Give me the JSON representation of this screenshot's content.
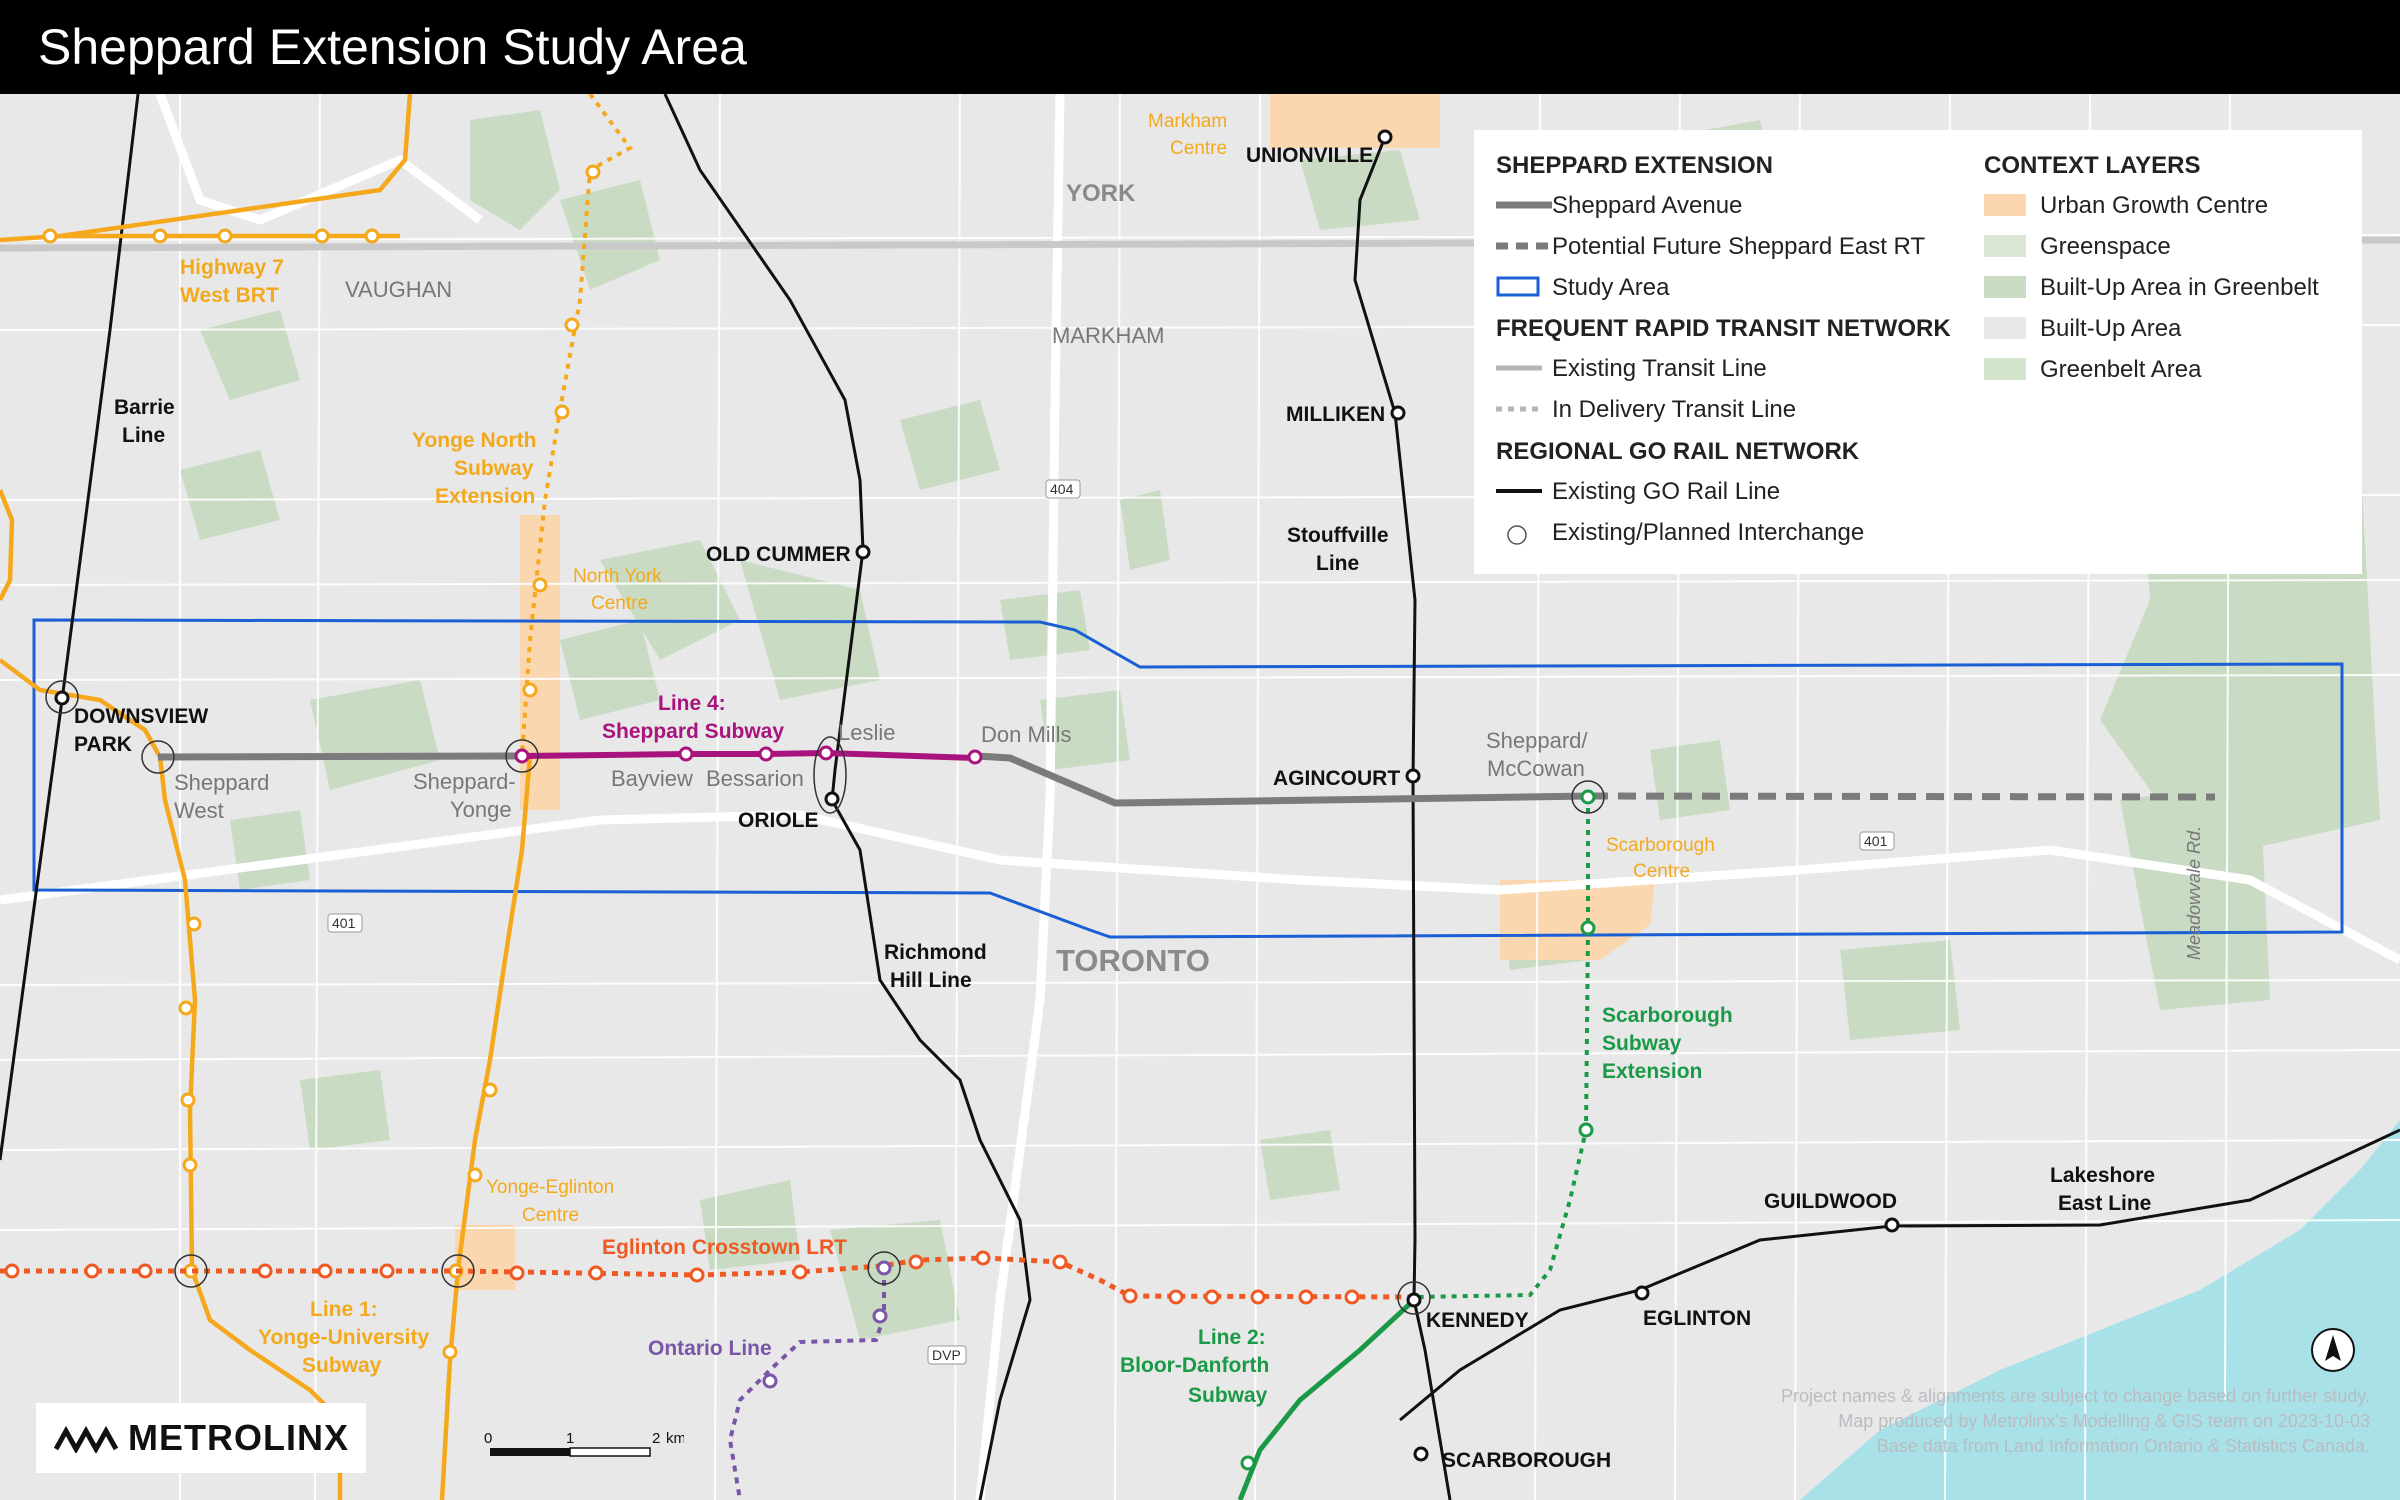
{
  "title": "Sheppard Extension Study Area",
  "colors": {
    "background": "#e8e8e8",
    "greenspace": "#c9dcc3",
    "water": "#a8e2e8",
    "urban_growth": "#fbd7b0",
    "study_area": "#1a5fd6",
    "sheppard_avenue": "#7b7b7b",
    "line4": "#a8137e",
    "line1": "#f5a81c",
    "line2": "#1a9a46",
    "eglinton": "#ef5a24",
    "ontario_line": "#7a56a8",
    "scarborough_ext": "#1a9a46",
    "go_rail": "#111111"
  },
  "map_labels": {
    "region_york": "YORK",
    "region_toronto": "TORONTO",
    "city_vaughan": "VAUGHAN",
    "city_markham": "MARKHAM",
    "highway7_l1": "Highway 7",
    "highway7_l2": "West BRT",
    "yonge_north_l1": "Yonge North",
    "yonge_north_l2": "Subway",
    "yonge_north_l3": "Extension",
    "markham_centre_l1": "Markham",
    "markham_centre_l2": "Centre",
    "north_york_l1": "North York",
    "north_york_l2": "Centre",
    "scarborough_centre_l1": "Scarborough",
    "scarborough_centre_l2": "Centre",
    "yonge_eglinton_l1": "Yonge-Eglinton",
    "yonge_eglinton_l2": "Centre",
    "barrie_l1": "Barrie",
    "barrie_l2": "Line",
    "richmond_l1": "Richmond",
    "richmond_l2": "Hill Line",
    "stouffville_l1": "Stouffville",
    "stouffville_l2": "Line",
    "lakeshore_l1": "Lakeshore",
    "lakeshore_l2": "East Line",
    "line4_l1": "Line 4:",
    "line4_l2": "Sheppard Subway",
    "line1_l1": "Line 1:",
    "line1_l2": "Yonge-University",
    "line1_l3": "Subway",
    "line2_l1": "Line 2:",
    "line2_l2": "Bloor-Danforth",
    "line2_l3": "Subway",
    "scarb_ext_l1": "Scarborough",
    "scarb_ext_l2": "Subway",
    "scarb_ext_l3": "Extension",
    "eglinton_lrt": "Eglinton Crosstown LRT",
    "ontario_line": "Ontario Line",
    "meadowvale": "Meadowvale Rd.",
    "hwy404": "404",
    "hwy401_a": "401",
    "hwy401_b": "401",
    "dvp": "DVP"
  },
  "stations": {
    "unionville": "UNIONVILLE",
    "milliken": "MILLIKEN",
    "old_cummer": "OLD CUMMER",
    "downsview_l1": "DOWNSVIEW",
    "downsview_l2": "PARK",
    "oriole": "ORIOLE",
    "agincourt": "AGINCOURT",
    "kennedy": "KENNEDY",
    "eglinton": "EGLINTON",
    "guildwood": "GUILDWOOD",
    "scarborough": "SCARBOROUGH",
    "sheppard_west_l1": "Sheppard",
    "sheppard_west_l2": "West",
    "sheppard_yonge_l1": "Sheppard-",
    "sheppard_yonge_l2": "Yonge",
    "bayview": "Bayview",
    "bessarion": "Bessarion",
    "leslie": "Leslie",
    "don_mills": "Don Mills",
    "sheppard_mccowan_l1": "Sheppard/",
    "sheppard_mccowan_l2": "McCowan"
  },
  "legend": {
    "sheppard_extension": {
      "heading": "SHEPPARD EXTENSION",
      "items": [
        "Sheppard Avenue",
        "Potential Future Sheppard East RT",
        "Study Area"
      ]
    },
    "frtn": {
      "heading": "FREQUENT RAPID TRANSIT NETWORK",
      "items": [
        "Existing Transit Line",
        "In Delivery Transit Line"
      ]
    },
    "go_rail": {
      "heading": "REGIONAL GO RAIL NETWORK",
      "items": [
        "Existing GO Rail Line",
        "Existing/Planned Interchange"
      ]
    },
    "context": {
      "heading": "CONTEXT LAYERS",
      "items": [
        "Urban Growth Centre",
        "Greenspace",
        "Built-Up Area in Greenbelt",
        "Built-Up Area",
        "Greenbelt Area"
      ]
    }
  },
  "scale_bar": {
    "labels": [
      "0",
      "1",
      "2"
    ],
    "unit": "km"
  },
  "logo": {
    "text": "METROLINX"
  },
  "credits": [
    "Project names & alignments are subject to change based on further study.",
    "Map produced by Metrolinx's Modelling & GIS team on 2023-10-03",
    "Base data from Land Information Ontario & Statistics Canada."
  ]
}
